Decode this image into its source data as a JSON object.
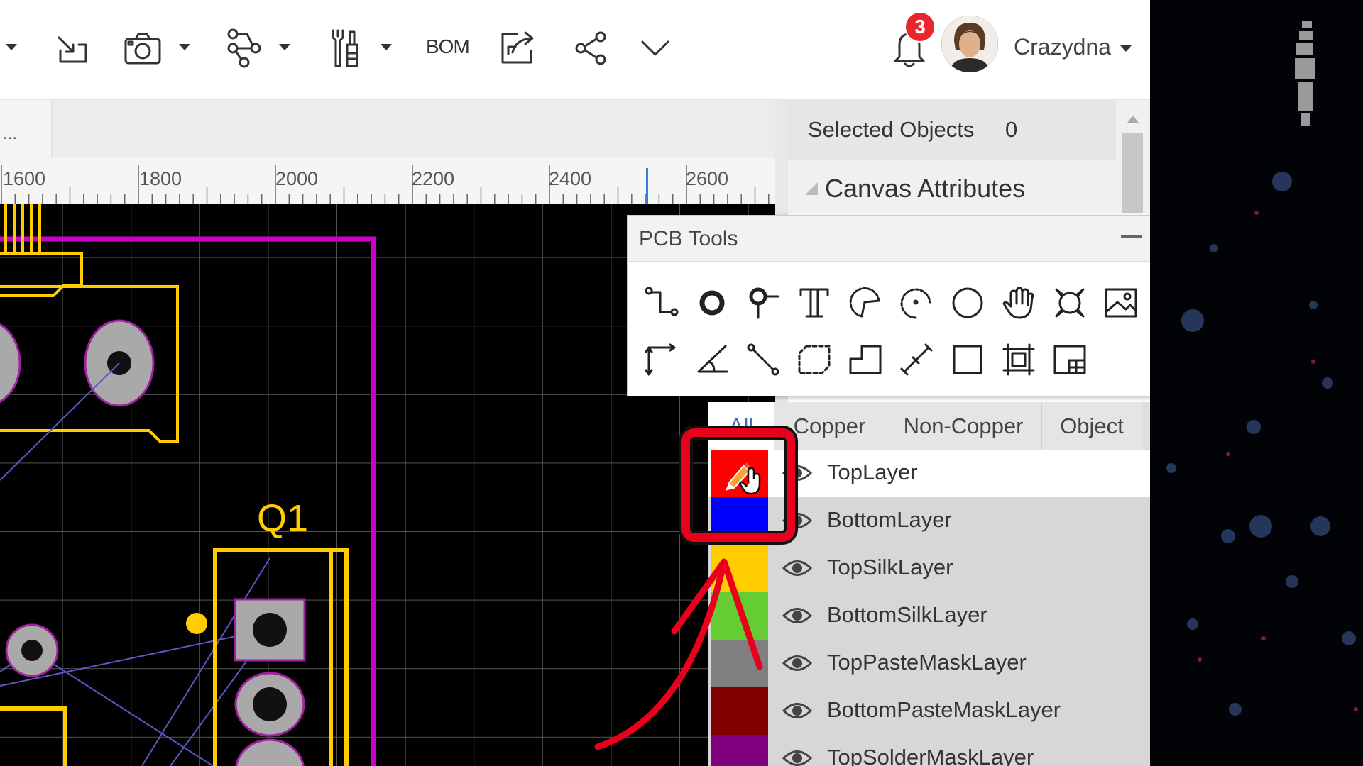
{
  "toolbar": {
    "bom_label": "BOM",
    "notification_count": "3",
    "username": "Crazydna",
    "icons": [
      "import-icon",
      "camera-icon",
      "share-network-icon",
      "tools-icon",
      "export-icon",
      "share-icon",
      "chevron-down-icon",
      "bell-icon"
    ]
  },
  "tabstrip": {
    "tab_label": "..."
  },
  "ruler": {
    "labels": [
      "1600",
      "1800",
      "2000",
      "2200",
      "2400",
      "2600"
    ]
  },
  "right_panel": {
    "selected_objects_label": "Selected Objects",
    "selected_objects_count": "0",
    "canvas_attributes_label": "Canvas Attributes"
  },
  "pcb_tools": {
    "title": "PCB Tools",
    "tools": [
      "track",
      "pad",
      "via",
      "text",
      "arc-3pt",
      "arc-center",
      "circle",
      "pan",
      "copper-area",
      "image",
      "dimension",
      "angle-dimension",
      "connect-pad",
      "solid-region",
      "cutout",
      "line",
      "rectangle",
      "group",
      "component"
    ]
  },
  "layers": {
    "tabs": [
      "All",
      "Copper",
      "Non-Copper",
      "Object"
    ],
    "active_tab": "All",
    "items": [
      {
        "name": "TopLayer",
        "color": "#ff0000"
      },
      {
        "name": "BottomLayer",
        "color": "#0000ff"
      },
      {
        "name": "TopSilkLayer",
        "color": "#ffcc00"
      },
      {
        "name": "BottomSilkLayer",
        "color": "#66cc33"
      },
      {
        "name": "TopPasteMaskLayer",
        "color": "#808080"
      },
      {
        "name": "BottomPasteMaskLayer",
        "color": "#800000"
      },
      {
        "name": "TopSolderMaskLayer",
        "color": "#800080"
      }
    ]
  },
  "pcb": {
    "component_label": "Q1"
  },
  "colors": {
    "silk": "#ffcc00",
    "outline": "#cc00cc",
    "highlight": "#e8001c"
  }
}
